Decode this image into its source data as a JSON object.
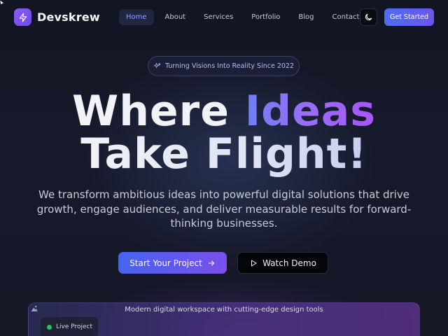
{
  "brand": {
    "name": "Devskrew",
    "logo_icon": "lightning-icon",
    "accent": "#7c5cf2"
  },
  "nav": {
    "links": [
      {
        "label": "Home",
        "active": true
      },
      {
        "label": "About",
        "active": false
      },
      {
        "label": "Services",
        "active": false
      },
      {
        "label": "Portfolio",
        "active": false
      },
      {
        "label": "Blog",
        "active": false
      },
      {
        "label": "Contact",
        "active": false
      }
    ],
    "theme_toggle_icon": "moon-icon",
    "cta_label": "Get Started"
  },
  "badge": {
    "icon": "sparkles-icon",
    "text": "Turning Visions Into Reality Since 2022"
  },
  "hero": {
    "line1_word1": "Where",
    "line1_word2": "Ideas",
    "line2": "Take Flight!",
    "subtitle": "We transform ambitious ideas into powerful digital solutions that drive growth, engage audiences, and deliver measurable results for forward-thinking businesses."
  },
  "actions": {
    "primary_label": "Start Your Project",
    "primary_icon": "arrow-right-icon",
    "secondary_label": "Watch Demo",
    "secondary_icon": "play-icon"
  },
  "preview": {
    "caption": "Modern digital workspace with cutting-edge design tools",
    "status_label": "Live Project",
    "status_color": "#22c55e"
  }
}
